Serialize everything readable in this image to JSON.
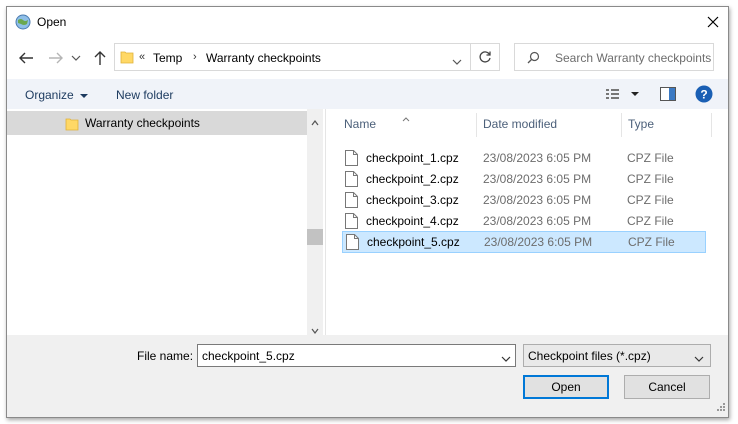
{
  "window": {
    "title": "Open"
  },
  "address": {
    "overflow": "«",
    "segments": [
      "Temp",
      "Warranty checkpoints"
    ]
  },
  "search": {
    "placeholder": "Search Warranty checkpoints"
  },
  "toolbar": {
    "organize": "Organize",
    "new_folder": "New folder"
  },
  "nav": {
    "items": [
      {
        "label": "Warranty checkpoints",
        "selected": true
      }
    ]
  },
  "columns": {
    "name": "Name",
    "date": "Date modified",
    "type": "Type"
  },
  "files": [
    {
      "name": "checkpoint_1.cpz",
      "date": "23/08/2023 6:05 PM",
      "type": "CPZ File"
    },
    {
      "name": "checkpoint_2.cpz",
      "date": "23/08/2023 6:05 PM",
      "type": "CPZ File"
    },
    {
      "name": "checkpoint_3.cpz",
      "date": "23/08/2023 6:05 PM",
      "type": "CPZ File"
    },
    {
      "name": "checkpoint_4.cpz",
      "date": "23/08/2023 6:05 PM",
      "type": "CPZ File"
    },
    {
      "name": "checkpoint_5.cpz",
      "date": "23/08/2023 6:05 PM",
      "type": "CPZ File",
      "selected": true
    }
  ],
  "bottom": {
    "file_name_label": "File name:",
    "file_name_value": "checkpoint_5.cpz",
    "filter": "Checkpoint files (*.cpz)",
    "open": "Open",
    "cancel": "Cancel"
  },
  "colors": {
    "selection": "#cce8ff",
    "selection_border": "#99d1ff",
    "accent": "#0078d7",
    "folder": "#ffd866"
  },
  "icons": {
    "app": "globe-icon",
    "close": "close-icon",
    "back": "arrow-left-icon",
    "forward": "arrow-right-icon",
    "recent": "chevron-down-icon",
    "up": "arrow-up-icon",
    "folder": "folder-icon",
    "refresh": "refresh-icon",
    "search": "search-icon",
    "view": "view-options-icon",
    "preview": "preview-pane-icon",
    "help": "help-icon",
    "file": "file-icon"
  }
}
